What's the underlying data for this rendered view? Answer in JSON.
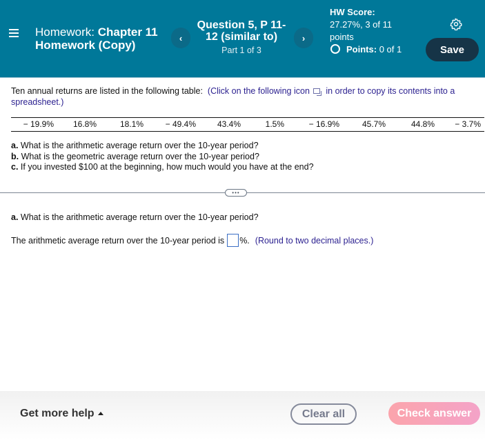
{
  "header": {
    "homework_label": "Homework:",
    "homework_name": "Chapter 11 Homework (Copy)",
    "question_title": "Question 5, P 11-12 (similar to)",
    "question_part": "Part 1 of 3",
    "prev_label": "‹",
    "next_label": "›",
    "hw_score_label": "HW Score:",
    "hw_score_value": "27.27%, 3 of 11 points",
    "points_label": "Points:",
    "points_value": "0 of 1",
    "save_label": "Save"
  },
  "problem": {
    "intro_text": "Ten annual returns are listed in the following table:",
    "intro_link_before": "(Click on the following icon",
    "intro_link_after": "in order to copy its contents into a spreadsheet.)",
    "returns": [
      "− 19.9%",
      "16.8%",
      "18.1%",
      "− 49.4%",
      "43.4%",
      "1.5%",
      "− 16.9%",
      "45.7%",
      "44.8%",
      "− 3.7%"
    ],
    "questions": [
      {
        "letter": "a.",
        "text": "What is the arithmetic average return over the 10-year period?"
      },
      {
        "letter": "b.",
        "text": "What is the geometric average return over the 10-year period?"
      },
      {
        "letter": "c.",
        "text": "If you invested $100 at the beginning, how much would you have at the end?"
      }
    ],
    "expand_label": "•••"
  },
  "current_part": {
    "letter": "a.",
    "question": "What is the arithmetic average return over the 10-year period?",
    "answer_prefix": "The arithmetic average return over the 10-year period is",
    "answer_value": "",
    "answer_suffix": "%.",
    "hint": "(Round to two decimal places.)"
  },
  "footer": {
    "help_label": "Get more help",
    "clear_label": "Clear all",
    "check_label": "Check answer"
  },
  "colors": {
    "header_bg": "#007899",
    "save_bg": "#163447",
    "link": "#2a1f8f",
    "check_answer_start": "#fba4ac",
    "check_answer_end": "#f4a3c8"
  }
}
